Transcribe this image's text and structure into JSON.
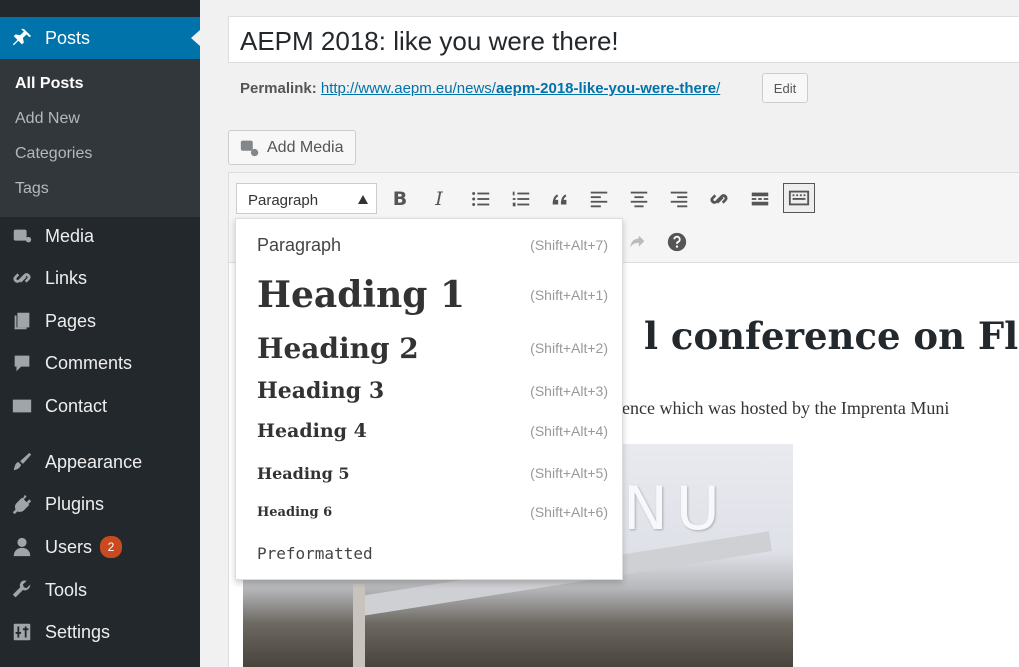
{
  "sidebar": {
    "posts": "Posts",
    "submenu": [
      "All Posts",
      "Add New",
      "Categories",
      "Tags"
    ],
    "items": [
      "Media",
      "Links",
      "Pages",
      "Comments",
      "Contact",
      "Appearance",
      "Plugins",
      "Users",
      "Tools",
      "Settings"
    ],
    "users_badge": "2"
  },
  "post": {
    "title": "AEPM 2018: like you were there!",
    "permalink_label": "Permalink:",
    "permalink_base": "http://www.aepm.eu/news/",
    "permalink_slug": "aepm-2018-like-you-were-there",
    "permalink_end": "/",
    "edit_label": "Edit",
    "add_media": "Add Media"
  },
  "editor": {
    "format_value": "Paragraph",
    "heading_text": "l conference on Flic",
    "paragraph_text": "ence which was hosted by the Imprenta Muni",
    "photo_text": "NU"
  },
  "dropdown": [
    {
      "label": "Paragraph",
      "shortcut": "(Shift+Alt+7)"
    },
    {
      "label": "Heading 1",
      "shortcut": "(Shift+Alt+1)"
    },
    {
      "label": "Heading 2",
      "shortcut": "(Shift+Alt+2)"
    },
    {
      "label": "Heading 3",
      "shortcut": "(Shift+Alt+3)"
    },
    {
      "label": "Heading 4",
      "shortcut": "(Shift+Alt+4)"
    },
    {
      "label": "Heading 5",
      "shortcut": "(Shift+Alt+5)"
    },
    {
      "label": "Heading 6",
      "shortcut": "(Shift+Alt+6)"
    },
    {
      "label": "Preformatted",
      "shortcut": ""
    }
  ],
  "colors": {
    "sidebar_bg": "#23282d",
    "active_bg": "#0073aa",
    "badge": "#ca4a1f",
    "link": "#0073aa"
  }
}
